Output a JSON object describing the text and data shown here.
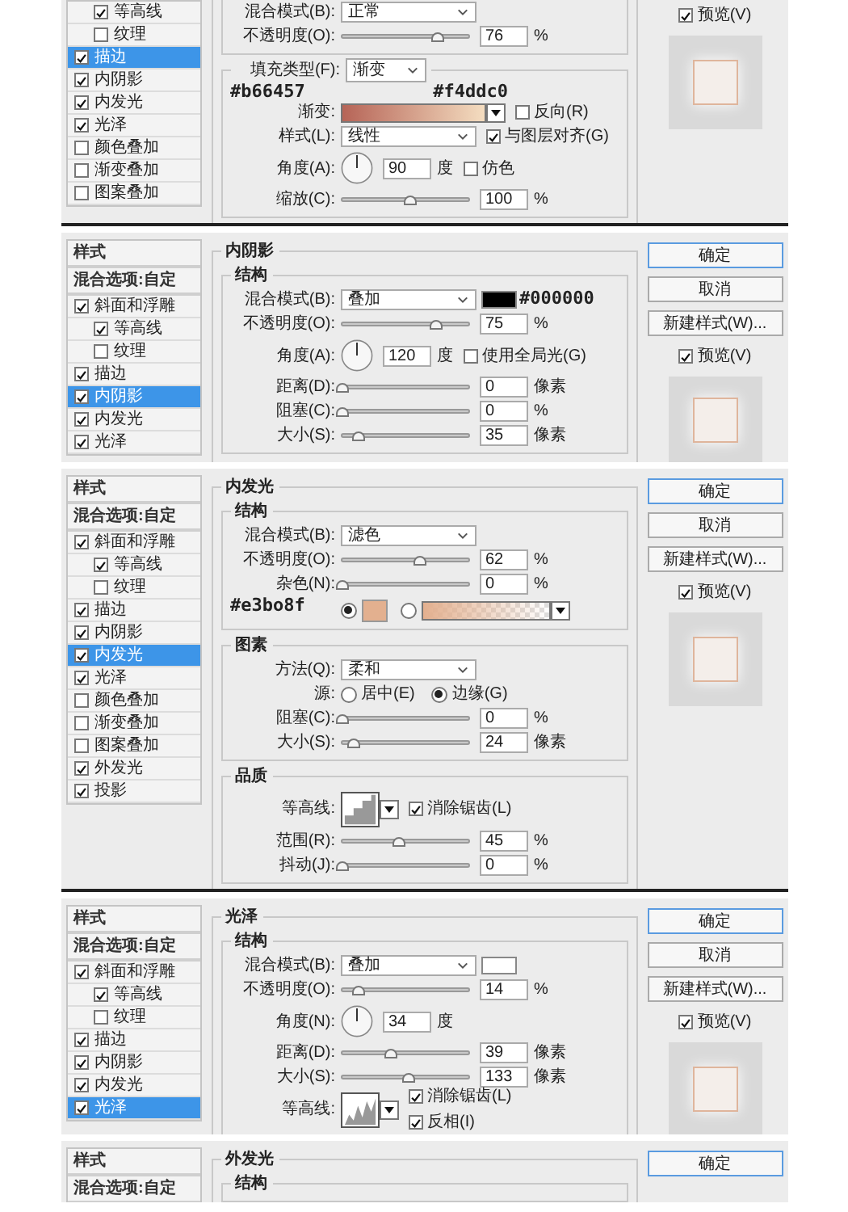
{
  "dialogs": [
    {
      "sidebar": {
        "items": [
          {
            "kind": "sub",
            "label": "等高线",
            "checked": true,
            "selected": false
          },
          {
            "kind": "sub",
            "label": "纹理",
            "checked": false,
            "selected": false
          },
          {
            "kind": "effect",
            "label": "描边",
            "checked": true,
            "selected": true
          },
          {
            "kind": "effect",
            "label": "内阴影",
            "checked": true,
            "selected": false
          },
          {
            "kind": "effect",
            "label": "内发光",
            "checked": true,
            "selected": false
          },
          {
            "kind": "effect",
            "label": "光泽",
            "checked": true,
            "selected": false
          },
          {
            "kind": "effect",
            "label": "颜色叠加",
            "checked": false,
            "selected": false
          },
          {
            "kind": "effect",
            "label": "渐变叠加",
            "checked": false,
            "selected": false
          },
          {
            "kind": "effect",
            "label": "图案叠加",
            "checked": false,
            "selected": false
          }
        ]
      },
      "groups": [
        {
          "rows": [
            {
              "kind": "select",
              "label": "混合模式(B):",
              "value": "正常"
            },
            {
              "kind": "slider",
              "label": "不透明度(O):",
              "level": 0.76,
              "value": "76",
              "unit": "%"
            }
          ]
        },
        {
          "legend": {
            "label": "填充类型(F):",
            "value": "渐变"
          },
          "rows": [
            {
              "kind": "gradient",
              "label": "渐变:",
              "start_annotation": "#b66457",
              "end_annotation": "#f4ddc0",
              "check": {
                "label": "反向(R)",
                "checked": false
              }
            },
            {
              "kind": "select",
              "label": "样式(L):",
              "value": "线性",
              "check": {
                "label": "与图层对齐(G)",
                "checked": true
              }
            },
            {
              "kind": "angle",
              "label": "角度(A):",
              "value": "90",
              "unit": "度",
              "check": {
                "label": "仿色",
                "checked": false
              }
            },
            {
              "kind": "slider",
              "label": "缩放(C):",
              "level": 0.55,
              "value": "100",
              "unit": "%"
            }
          ]
        }
      ],
      "preview": {
        "label": "预览(V)",
        "checked": true
      }
    },
    {
      "sidebar": {
        "items": [
          {
            "kind": "header",
            "label": "样式"
          },
          {
            "kind": "header",
            "label": "混合选项:自定"
          },
          {
            "kind": "effect",
            "label": "斜面和浮雕",
            "checked": true,
            "selected": false,
            "children": [
              {
                "kind": "effect",
                "label": "等高线",
                "checked": true,
                "selected": false
              },
              {
                "kind": "effect",
                "label": "纹理",
                "checked": false,
                "selected": false
              }
            ]
          },
          {
            "kind": "effect",
            "label": "描边",
            "checked": true,
            "selected": false
          },
          {
            "kind": "effect",
            "label": "内阴影",
            "checked": true,
            "selected": true
          },
          {
            "kind": "effect",
            "label": "内发光",
            "checked": true,
            "selected": false
          },
          {
            "kind": "effect",
            "label": "光泽",
            "checked": true,
            "selected": false
          }
        ]
      },
      "title": "内阴影",
      "groups": [
        {
          "title": "结构",
          "rows": [
            {
              "kind": "select",
              "label": "混合模式(B):",
              "value": "叠加",
              "color": "#000000",
              "color_annotation": "#000000"
            },
            {
              "kind": "slider",
              "label": "不透明度(O):",
              "level": 0.75,
              "value": "75",
              "unit": "%"
            },
            {
              "kind": "angle",
              "label": "角度(A):",
              "value": "120",
              "unit": "度",
              "check": {
                "label": "使用全局光(G)",
                "checked": false
              }
            },
            {
              "kind": "slider",
              "label": "距离(D):",
              "level": 0,
              "value": "0",
              "unit": "像素"
            },
            {
              "kind": "slider",
              "label": "阻塞(C):",
              "level": 0,
              "value": "0",
              "unit": "%"
            },
            {
              "kind": "slider",
              "label": "大小(S):",
              "level": 0.14,
              "value": "35",
              "unit": "像素"
            }
          ]
        }
      ],
      "actions": [
        {
          "label": "确定",
          "kind": "default"
        },
        {
          "label": "取消",
          "kind": "normal"
        },
        {
          "label": "新建样式(W)...",
          "kind": "normal"
        }
      ],
      "preview": {
        "label": "预览(V)",
        "checked": true
      }
    },
    {
      "sidebar": {
        "items": [
          {
            "kind": "header",
            "label": "样式"
          },
          {
            "kind": "header",
            "label": "混合选项:自定"
          },
          {
            "kind": "effect",
            "label": "斜面和浮雕",
            "checked": true,
            "selected": false,
            "children": [
              {
                "kind": "effect",
                "label": "等高线",
                "checked": true,
                "selected": false
              },
              {
                "kind": "effect",
                "label": "纹理",
                "checked": false,
                "selected": false
              }
            ]
          },
          {
            "kind": "effect",
            "label": "描边",
            "checked": true,
            "selected": false
          },
          {
            "kind": "effect",
            "label": "内阴影",
            "checked": true,
            "selected": false
          },
          {
            "kind": "effect",
            "label": "内发光",
            "checked": true,
            "selected": true
          },
          {
            "kind": "effect",
            "label": "光泽",
            "checked": true,
            "selected": false
          },
          {
            "kind": "effect",
            "label": "颜色叠加",
            "checked": false,
            "selected": false
          },
          {
            "kind": "effect",
            "label": "渐变叠加",
            "checked": false,
            "selected": false
          },
          {
            "kind": "effect",
            "label": "图案叠加",
            "checked": false,
            "selected": false
          },
          {
            "kind": "effect",
            "label": "外发光",
            "checked": true,
            "selected": false
          },
          {
            "kind": "effect",
            "label": "投影",
            "checked": true,
            "selected": false
          }
        ]
      },
      "title": "内发光",
      "groups": [
        {
          "title": "结构",
          "rows": [
            {
              "kind": "select",
              "label": "混合模式(B):",
              "value": "滤色"
            },
            {
              "kind": "slider",
              "label": "不透明度(O):",
              "level": 0.62,
              "value": "62",
              "unit": "%"
            },
            {
              "kind": "slider",
              "label": "杂色(N):",
              "level": 0,
              "value": "0",
              "unit": "%"
            },
            {
              "kind": "glow-color",
              "annotation": "#e3bo8f",
              "color": "#e3b08f",
              "options": [
                {
                  "kind": "solid",
                  "selected": true
                },
                {
                  "kind": "gradient",
                  "selected": false
                }
              ]
            }
          ]
        },
        {
          "title": "图素",
          "rows": [
            {
              "kind": "select",
              "label": "方法(Q):",
              "value": "柔和"
            },
            {
              "kind": "source",
              "label": "源:",
              "options": [
                {
                  "label": "居中(E)",
                  "selected": false
                },
                {
                  "label": "边缘(G)",
                  "selected": true
                }
              ]
            },
            {
              "kind": "slider",
              "label": "阻塞(C):",
              "level": 0,
              "value": "0",
              "unit": "%"
            },
            {
              "kind": "slider",
              "label": "大小(S):",
              "level": 0.1,
              "value": "24",
              "unit": "像素"
            }
          ]
        },
        {
          "title": "品质",
          "rows": [
            {
              "kind": "stepcontour",
              "label": "等高线:",
              "checks": [
                {
                  "label": "消除锯齿(L)",
                  "checked": true
                }
              ]
            },
            {
              "kind": "slider",
              "label": "范围(R):",
              "level": 0.45,
              "value": "45",
              "unit": "%"
            },
            {
              "kind": "slider",
              "label": "抖动(J):",
              "level": 0,
              "value": "0",
              "unit": "%"
            }
          ]
        }
      ],
      "actions": [
        {
          "label": "确定",
          "kind": "default"
        },
        {
          "label": "取消",
          "kind": "normal"
        },
        {
          "label": "新建样式(W)...",
          "kind": "normal"
        }
      ],
      "preview": {
        "label": "预览(V)",
        "checked": true
      }
    },
    {
      "sidebar": {
        "items": [
          {
            "kind": "header",
            "label": "样式"
          },
          {
            "kind": "header",
            "label": "混合选项:自定"
          },
          {
            "kind": "effect",
            "label": "斜面和浮雕",
            "checked": true,
            "selected": false,
            "children": [
              {
                "kind": "effect",
                "label": "等高线",
                "checked": true,
                "selected": false
              },
              {
                "kind": "effect",
                "label": "纹理",
                "checked": false,
                "selected": false
              }
            ]
          },
          {
            "kind": "effect",
            "label": "描边",
            "checked": true,
            "selected": false
          },
          {
            "kind": "effect",
            "label": "内阴影",
            "checked": true,
            "selected": false
          },
          {
            "kind": "effect",
            "label": "内发光",
            "checked": true,
            "selected": false
          },
          {
            "kind": "effect",
            "label": "光泽",
            "checked": true,
            "selected": true
          }
        ]
      },
      "title": "光泽",
      "groups": [
        {
          "title": "结构",
          "rows": [
            {
              "kind": "select",
              "label": "混合模式(B):",
              "value": "叠加",
              "color": "#ffffff"
            },
            {
              "kind": "slider",
              "label": "不透明度(O):",
              "level": 0.14,
              "value": "14",
              "unit": "%"
            },
            {
              "kind": "angle",
              "label": "角度(N):",
              "value": "34",
              "unit": "度"
            },
            {
              "kind": "slider",
              "label": "距离(D):",
              "level": 0.39,
              "value": "39",
              "unit": "像素"
            },
            {
              "kind": "slider",
              "label": "大小(S):",
              "level": 0.53,
              "value": "133",
              "unit": "像素"
            },
            {
              "kind": "peakcontour",
              "label": "等高线:",
              "checks": [
                {
                  "label": "消除锯齿(L)",
                  "checked": true
                },
                {
                  "label": "反相(I)",
                  "checked": true
                }
              ]
            }
          ]
        }
      ],
      "actions": [
        {
          "label": "确定",
          "kind": "default"
        },
        {
          "label": "取消",
          "kind": "normal"
        },
        {
          "label": "新建样式(W)...",
          "kind": "normal"
        }
      ],
      "preview": {
        "label": "预览(V)",
        "checked": true
      }
    },
    {
      "sidebar": {
        "items": [
          {
            "kind": "header",
            "label": "样式"
          },
          {
            "kind": "header",
            "label": "混合选项:自定"
          }
        ]
      },
      "title": "外发光",
      "groups": [
        {
          "title": "结构"
        }
      ],
      "actions": [
        {
          "label": "确定",
          "kind": "default"
        }
      ]
    }
  ]
}
